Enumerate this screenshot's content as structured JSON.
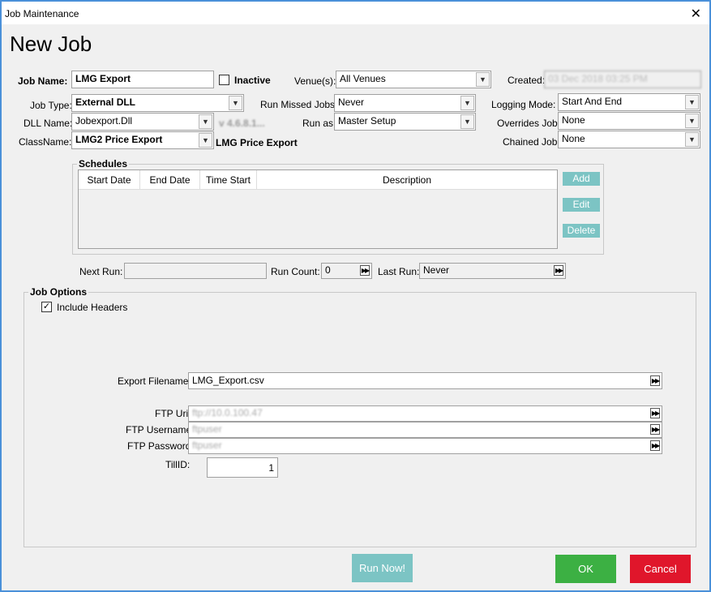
{
  "window": {
    "title": "Job Maintenance",
    "close_glyph": "✕"
  },
  "heading": "New Job",
  "job_name": {
    "label": "Job Name:",
    "value": "LMG Export"
  },
  "inactive": {
    "label": "Inactive",
    "checked": false
  },
  "venues": {
    "label": "Venue(s):",
    "value": "All Venues"
  },
  "created": {
    "label": "Created:",
    "value": "03 Dec 2018 03:25 PM"
  },
  "job_type": {
    "label": "Job Type:",
    "value": "External DLL"
  },
  "run_missed": {
    "label": "Run Missed Jobs:",
    "value": "Never"
  },
  "logging_mode": {
    "label": "Logging Mode:",
    "value": "Start And End"
  },
  "dll_name": {
    "label": "DLL Name:",
    "value": "Jobexport.Dll",
    "version": "v 4.6.8.1..."
  },
  "run_as": {
    "label": "Run as:",
    "value": "Master Setup"
  },
  "overrides_job": {
    "label": "Overrides Job:",
    "value": "None"
  },
  "class_name": {
    "label": "ClassName:",
    "value": "LMG2 Price Export",
    "display": "LMG Price Export"
  },
  "chained_job": {
    "label": "Chained Job:",
    "value": "None"
  },
  "schedules": {
    "title": "Schedules",
    "columns": [
      "Start Date",
      "End Date",
      "Time Start",
      "Description"
    ],
    "add_label": "Add",
    "edit_label": "Edit",
    "delete_label": "Delete"
  },
  "next_run": {
    "label": "Next Run:",
    "value": ""
  },
  "run_count": {
    "label": "Run Count:",
    "value": "0"
  },
  "last_run": {
    "label": "Last Run:",
    "value": "Never"
  },
  "job_options": {
    "title": "Job Options",
    "include_headers": {
      "label": "Include Headers",
      "checked": true
    },
    "export_filename": {
      "label": "Export Filename",
      "value": "LMG_Export.csv"
    },
    "ftp_uri": {
      "label": "FTP Uri",
      "value": "ftp://10.0.100.47"
    },
    "ftp_username": {
      "label": "FTP Username",
      "value": "ftpuser"
    },
    "ftp_password": {
      "label": "FTP Password",
      "value": "ftpuser"
    },
    "till_id": {
      "label": "TillID:",
      "value": "1"
    }
  },
  "buttons": {
    "run_now": "Run Now!",
    "ok": "OK",
    "cancel": "Cancel"
  },
  "icons": {
    "dropdown": "chevron-down-icon",
    "ellipsis": "fast-forward-icon",
    "check": "✓"
  },
  "colors": {
    "teal": "#7cc4c4",
    "ok_green": "#3cb043",
    "cancel_red": "#e0162b",
    "border_blue": "#4a90d9"
  }
}
